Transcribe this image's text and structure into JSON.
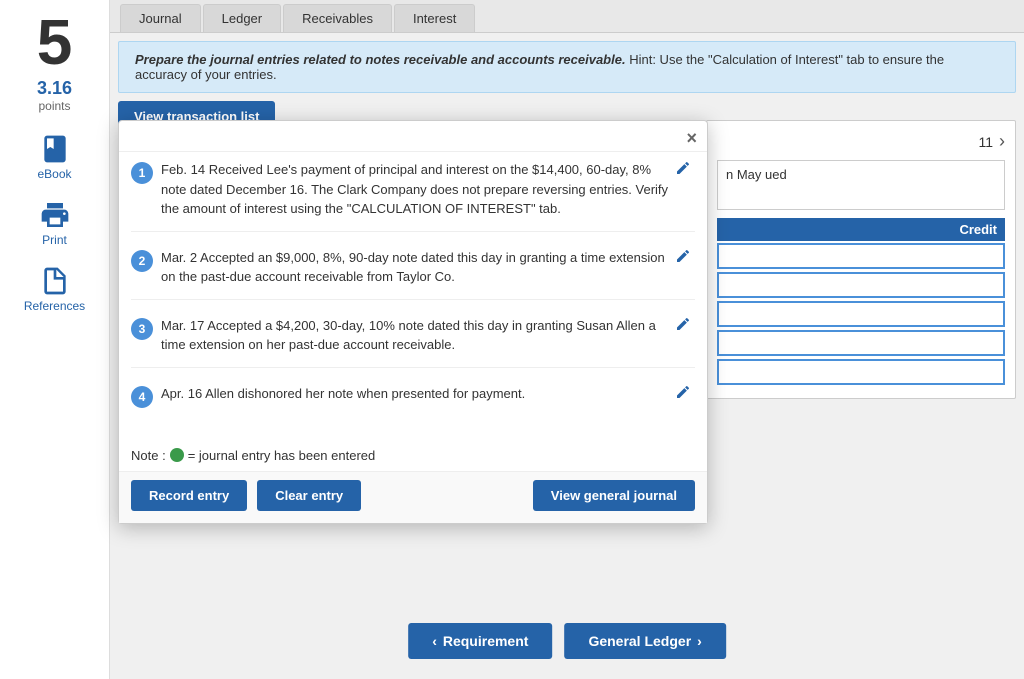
{
  "sidebar": {
    "step_number": "5",
    "points": {
      "value": "3.16",
      "label": "points"
    },
    "icons": [
      {
        "name": "ebook-icon",
        "label": "eBook",
        "id": "ebook"
      },
      {
        "name": "print-icon",
        "label": "Print",
        "id": "print"
      },
      {
        "name": "references-icon",
        "label": "References",
        "id": "references"
      }
    ]
  },
  "tabs": [
    {
      "label": "Journal",
      "active": false
    },
    {
      "label": "Ledger",
      "active": false
    },
    {
      "label": "Receivables",
      "active": false
    },
    {
      "label": "Interest",
      "active": false
    }
  ],
  "instruction": {
    "bold_part": "Prepare the journal entries related to notes receivable and accounts receivable.",
    "regular_part": " Hint:  Use the \"Calculation of Interest\" tab to ensure the accuracy of your entries."
  },
  "view_transaction_btn": "View transaction list",
  "modal": {
    "close_label": "×",
    "transactions": [
      {
        "num": "1",
        "text": "Feb. 14 Received Lee's payment of principal and interest on the $14,400, 60-day, 8% note dated December 16. The Clark Company does not prepare reversing entries. Verify the amount of interest using the \"CALCULATION OF INTEREST\" tab.",
        "entered": false
      },
      {
        "num": "2",
        "text": "Mar. 2 Accepted an $9,000, 8%, 90-day note dated this day in granting a time extension on the past-due account receivable from Taylor Co.",
        "entered": false
      },
      {
        "num": "3",
        "text": "Mar. 17 Accepted a $4,200, 30-day, 10% note dated this day in granting Susan Allen a time extension on her past-due account receivable.",
        "entered": false
      },
      {
        "num": "4",
        "text": "Apr. 16 Allen dishonored her note when presented for payment.",
        "entered": false
      }
    ],
    "note_text": "Note :",
    "note_description": "= journal entry has been entered",
    "buttons": {
      "record": "Record entry",
      "clear": "Clear entry",
      "view_journal": "View general journal"
    }
  },
  "journal_area": {
    "nav_number": "11",
    "date_description": "n May\nued",
    "credit_header": "Credit",
    "inputs": [
      "",
      "",
      "",
      "",
      ""
    ]
  },
  "bottom_nav": {
    "requirement_label": "Requirement",
    "general_ledger_label": "General Ledger"
  }
}
